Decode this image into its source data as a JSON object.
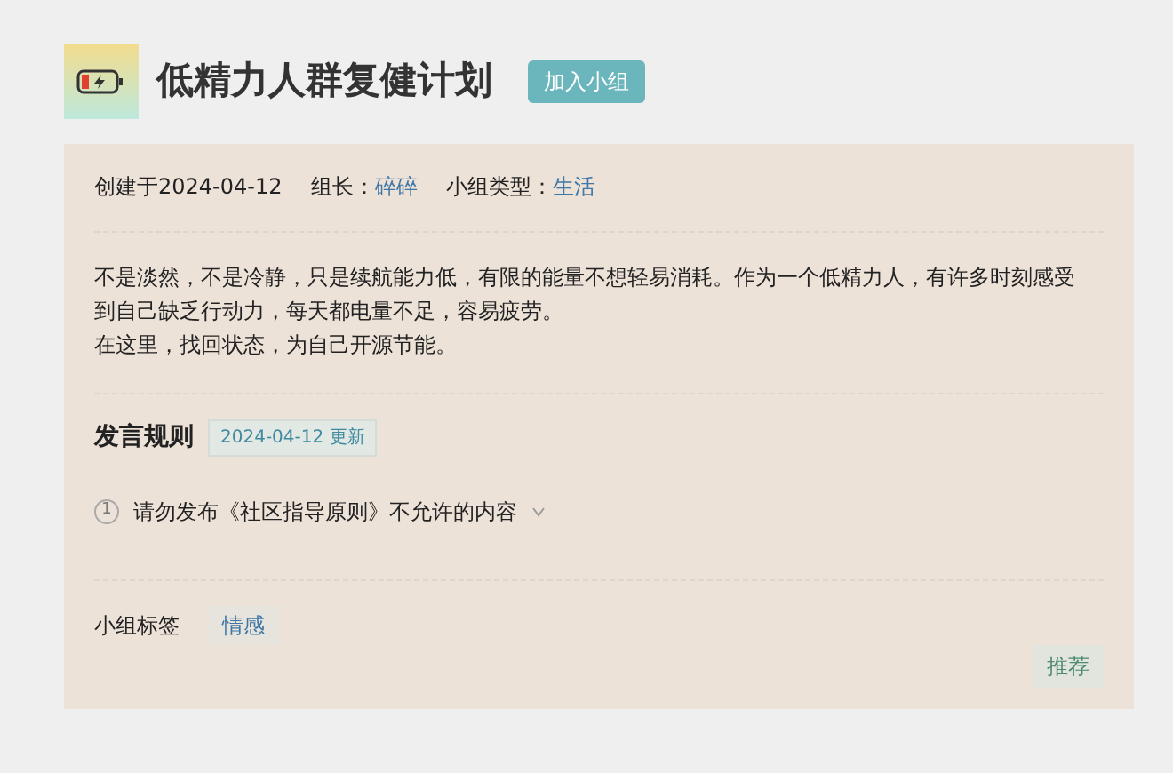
{
  "group": {
    "title": "低精力人群复健计划",
    "join_button": "加入小组"
  },
  "meta": {
    "created": "创建于2024-04-12",
    "leader_label": "组长：",
    "leader": "碎碎",
    "type_label": "小组类型：",
    "type": "生活"
  },
  "description": [
    "不是淡然，不是冷静，只是续航能力低，有限的能量不想轻易消耗。作为一个低精力人，有许多时刻感受到自己缺乏行动力，每天都电量不足，容易疲劳。",
    "在这里，找回状态，为自己开源节能。"
  ],
  "rules": {
    "title": "发言规则",
    "updated": "2024-04-12 更新",
    "items": [
      {
        "number": "1",
        "text": "请勿发布《社区指导原则》不允许的内容",
        "expanded": false
      }
    ]
  },
  "tags": {
    "label": "小组标签",
    "items": [
      "情感"
    ]
  },
  "recommend_button": "推荐"
}
